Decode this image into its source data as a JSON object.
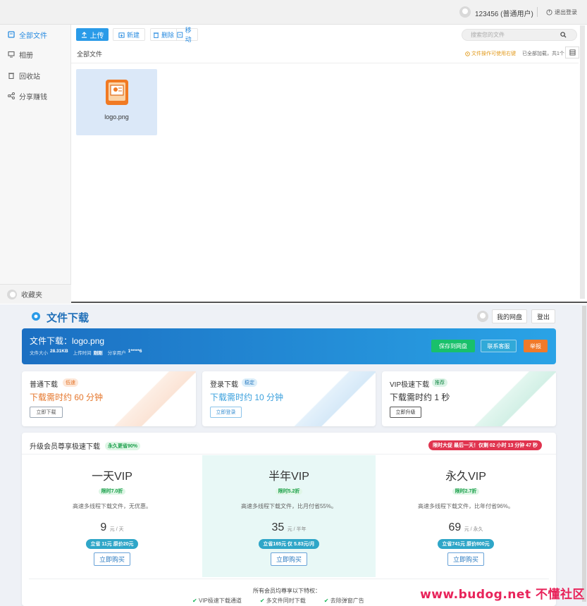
{
  "file_manager": {
    "user": {
      "name": "123456 (普通用户)",
      "logout": "退出登录"
    },
    "sidebar": {
      "items": [
        {
          "label": "全部文件",
          "icon": "folder-icon",
          "active": true
        },
        {
          "label": "相册",
          "icon": "monitor-icon",
          "active": false
        },
        {
          "label": "回收站",
          "icon": "trash-icon",
          "active": false
        },
        {
          "label": "分享赚钱",
          "icon": "share-icon",
          "active": false
        }
      ],
      "bottom": "收藏夹"
    },
    "toolbar": {
      "upload": "上传",
      "new": "新建",
      "delete": "删除",
      "move": "移动"
    },
    "search": {
      "placeholder": "搜索您的文件"
    },
    "breadcrumb": "全部文件",
    "notice": "文件操作可使用右键",
    "loaded": "已全部加载，共1个",
    "files": [
      {
        "name": "logo.png"
      }
    ]
  },
  "download_page": {
    "brand": "文件下载",
    "header": {
      "my_disk": "我的网盘",
      "logout": "登出"
    },
    "banner": {
      "title": "文件下载：logo.png",
      "size_label": "文件大小",
      "size": "28.31KB",
      "time_label": "上传时间",
      "time": "刚刚",
      "sharer_label": "分享用户",
      "sharer": "1*****6",
      "save": "保存到网盘",
      "contact": "联系客服",
      "report": "举报"
    },
    "download_options": [
      {
        "title": "普通下载",
        "tag": "低速",
        "wait": "下载需时约 60 分钟",
        "button": "立即下载"
      },
      {
        "title": "登录下载",
        "tag": "稳定",
        "wait": "下载需时约 10 分钟",
        "button": "立即登录"
      },
      {
        "title": "VIP极速下载",
        "tag": "推荐",
        "wait": "下载需时约 1 秒",
        "button": "立即升级"
      }
    ],
    "vip": {
      "title": "升级会员尊享极速下载",
      "badge": "永久更省90%",
      "promo": "限时大促 最后一天！仅剩 02 小时 13 分钟 47 秒",
      "plans": [
        {
          "name": "一天VIP",
          "discount": "限时7.0折",
          "desc": "高速多线程下载文件，无优惠。",
          "price": "9",
          "unit": "元 / 天",
          "save": "立省 11元 原价20元",
          "buy": "立即购买"
        },
        {
          "name": "半年VIP",
          "discount": "限时5.2折",
          "desc": "高速多线程下载文件，比月付省55%。",
          "price": "35",
          "unit": "元 / 半年",
          "save": "立省165元 仅 5.83元/月",
          "buy": "立即购买"
        },
        {
          "name": "永久VIP",
          "discount": "限时2.7折",
          "desc": "高速多线程下载文件，比年付省96%。",
          "price": "69",
          "unit": "元 / 永久",
          "save": "立省741元 原价800元",
          "buy": "立即购买"
        }
      ],
      "perks_title": "所有会员均尊享以下特权：",
      "perks": [
        "VIP极速下载通道",
        "多文件同时下载",
        "去除弹窗广告"
      ]
    }
  },
  "watermark": "www.budog.net 不懂社区",
  "colors": {
    "primary": "#2a9be8",
    "orange_btn": "#f07a2a",
    "green_btn": "#19c06b",
    "banner_start": "#1b6fc2",
    "banner_end": "#2aa3e6"
  }
}
